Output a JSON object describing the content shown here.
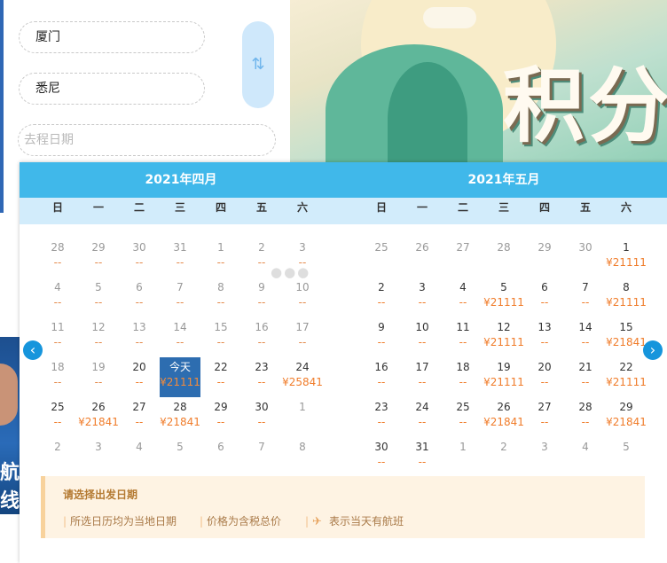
{
  "form": {
    "top_banner_text": "",
    "from_city": "厦门",
    "to_city": "悉尼",
    "date_placeholder": "去程日期",
    "swap_icon": "swap-vertical-icon"
  },
  "banner": {
    "text": "积分"
  },
  "left_photo": {
    "text": "航线"
  },
  "calendar": {
    "weekdays": [
      "日",
      "一",
      "二",
      "三",
      "四",
      "五",
      "六"
    ],
    "months": [
      {
        "title": "2021年四月",
        "weeks": [
          [
            {
              "d": "28",
              "p": "--",
              "o": true
            },
            {
              "d": "29",
              "p": "--",
              "o": true
            },
            {
              "d": "30",
              "p": "--",
              "o": true
            },
            {
              "d": "31",
              "p": "--",
              "o": true
            },
            {
              "d": "1",
              "p": "--",
              "o": true
            },
            {
              "d": "2",
              "p": "--",
              "o": true
            },
            {
              "d": "3",
              "p": "--",
              "o": true
            }
          ],
          [
            {
              "d": "4",
              "p": "--",
              "o": true
            },
            {
              "d": "5",
              "p": "--",
              "o": true
            },
            {
              "d": "6",
              "p": "--",
              "o": true
            },
            {
              "d": "7",
              "p": "--",
              "o": true
            },
            {
              "d": "8",
              "p": "--",
              "o": true
            },
            {
              "d": "9",
              "p": "--",
              "o": true
            },
            {
              "d": "10",
              "p": "--",
              "o": true
            }
          ],
          [
            {
              "d": "11",
              "p": "--",
              "o": true
            },
            {
              "d": "12",
              "p": "--",
              "o": true
            },
            {
              "d": "13",
              "p": "--",
              "o": true
            },
            {
              "d": "14",
              "p": "--",
              "o": true
            },
            {
              "d": "15",
              "p": "--",
              "o": true
            },
            {
              "d": "16",
              "p": "--",
              "o": true
            },
            {
              "d": "17",
              "p": "--",
              "o": true
            }
          ],
          [
            {
              "d": "18",
              "p": "--",
              "o": true
            },
            {
              "d": "19",
              "p": "--",
              "o": true
            },
            {
              "d": "20",
              "p": "--"
            },
            {
              "d": "今天",
              "p": "¥21111",
              "t": true
            },
            {
              "d": "22",
              "p": "--"
            },
            {
              "d": "23",
              "p": "--"
            },
            {
              "d": "24",
              "p": "¥25841"
            }
          ],
          [
            {
              "d": "25",
              "p": "--"
            },
            {
              "d": "26",
              "p": "¥21841"
            },
            {
              "d": "27",
              "p": "--"
            },
            {
              "d": "28",
              "p": "¥21841"
            },
            {
              "d": "29",
              "p": "--"
            },
            {
              "d": "30",
              "p": "--"
            },
            {
              "d": "1",
              "p": "",
              "o": true
            }
          ],
          [
            {
              "d": "2",
              "p": "",
              "o": true
            },
            {
              "d": "3",
              "p": "",
              "o": true
            },
            {
              "d": "4",
              "p": "",
              "o": true
            },
            {
              "d": "5",
              "p": "",
              "o": true
            },
            {
              "d": "6",
              "p": "",
              "o": true
            },
            {
              "d": "7",
              "p": "",
              "o": true
            },
            {
              "d": "8",
              "p": "",
              "o": true
            }
          ]
        ]
      },
      {
        "title": "2021年五月",
        "weeks": [
          [
            {
              "d": "25",
              "p": "",
              "o": true
            },
            {
              "d": "26",
              "p": "",
              "o": true
            },
            {
              "d": "27",
              "p": "",
              "o": true
            },
            {
              "d": "28",
              "p": "",
              "o": true
            },
            {
              "d": "29",
              "p": "",
              "o": true
            },
            {
              "d": "30",
              "p": "",
              "o": true
            },
            {
              "d": "1",
              "p": "¥21111"
            }
          ],
          [
            {
              "d": "2",
              "p": "--"
            },
            {
              "d": "3",
              "p": "--"
            },
            {
              "d": "4",
              "p": "--"
            },
            {
              "d": "5",
              "p": "¥21111"
            },
            {
              "d": "6",
              "p": "--"
            },
            {
              "d": "7",
              "p": "--"
            },
            {
              "d": "8",
              "p": "¥21111"
            }
          ],
          [
            {
              "d": "9",
              "p": "--"
            },
            {
              "d": "10",
              "p": "--"
            },
            {
              "d": "11",
              "p": "--"
            },
            {
              "d": "12",
              "p": "¥21111"
            },
            {
              "d": "13",
              "p": "--"
            },
            {
              "d": "14",
              "p": "--"
            },
            {
              "d": "15",
              "p": "¥21841"
            }
          ],
          [
            {
              "d": "16",
              "p": "--"
            },
            {
              "d": "17",
              "p": "--"
            },
            {
              "d": "18",
              "p": "--"
            },
            {
              "d": "19",
              "p": "¥21111"
            },
            {
              "d": "20",
              "p": "--"
            },
            {
              "d": "21",
              "p": "--"
            },
            {
              "d": "22",
              "p": "¥21111"
            }
          ],
          [
            {
              "d": "23",
              "p": "--"
            },
            {
              "d": "24",
              "p": "--"
            },
            {
              "d": "25",
              "p": "--"
            },
            {
              "d": "26",
              "p": "¥21841"
            },
            {
              "d": "27",
              "p": "--"
            },
            {
              "d": "28",
              "p": "--"
            },
            {
              "d": "29",
              "p": "¥21841"
            }
          ],
          [
            {
              "d": "30",
              "p": "--"
            },
            {
              "d": "31",
              "p": "--"
            },
            {
              "d": "1",
              "p": "",
              "o": true
            },
            {
              "d": "2",
              "p": "",
              "o": true
            },
            {
              "d": "3",
              "p": "",
              "o": true
            },
            {
              "d": "4",
              "p": "",
              "o": true
            },
            {
              "d": "5",
              "p": "",
              "o": true
            }
          ]
        ]
      }
    ],
    "prev_icon": "chevron-left-icon",
    "next_icon": "chevron-right-icon",
    "prev_glyph": "‹",
    "next_glyph": "›"
  },
  "notice": {
    "title": "请选择出发日期",
    "items": [
      "所选日历均为当地日期",
      "价格为含税总价",
      "表示当天有航班"
    ],
    "plane_glyph": "✈"
  },
  "colors": {
    "header": "#40b8ea",
    "weekday_bg": "#d2ecfb",
    "price": "#f07c2a",
    "today": "#2d6db0"
  }
}
